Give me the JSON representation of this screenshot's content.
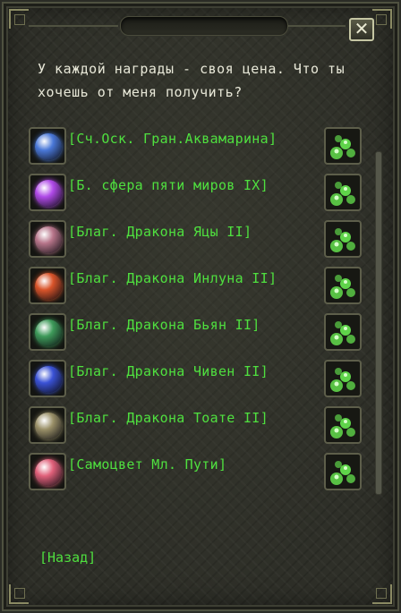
{
  "dialog": {
    "close_label": "✕",
    "npc_text": "У каждой награды - своя цена. Что ты\nхочешь от меня получить?",
    "items": [
      {
        "label": "[Сч.Оск. Гран.Аквамарина]",
        "icon": "aquamarine-shard-icon",
        "color": "#4a78d8"
      },
      {
        "label": "[Б. сфера пяти миров IX]",
        "icon": "five-worlds-sphere-icon",
        "color": "#b04ae8"
      },
      {
        "label": "[Благ. Дракона Яцы II]",
        "icon": "dragon-orb-yatsy-icon",
        "color": "#b7758a"
      },
      {
        "label": "[Благ. Дракона Инлуна II]",
        "icon": "dragon-orb-inluna-icon",
        "color": "#d9542a"
      },
      {
        "label": "[Благ. Дракона Бьян II]",
        "icon": "dragon-orb-byan-icon",
        "color": "#3e9a5a"
      },
      {
        "label": "[Благ. Дракона Чивен II]",
        "icon": "dragon-orb-chiven-icon",
        "color": "#3a52d6"
      },
      {
        "label": "[Благ. Дракона Тоате II]",
        "icon": "dragon-orb-toate-icon",
        "color": "#9a9068"
      },
      {
        "label": "[Самоцвет Мл. Пути]",
        "icon": "path-gem-icon",
        "color": "#e0607a"
      }
    ],
    "reward_icon": "jade-reward-icon",
    "reward_color": "#5fd44a",
    "back_label": "[Назад]"
  }
}
